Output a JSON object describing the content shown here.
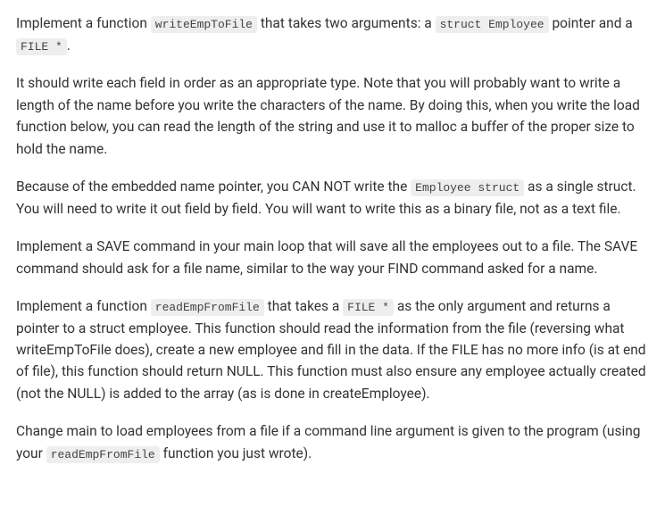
{
  "paragraphs": [
    {
      "segments": [
        {
          "type": "text",
          "value": "Implement a function "
        },
        {
          "type": "code",
          "value": "writeEmpToFile"
        },
        {
          "type": "text",
          "value": " that takes two arguments: a "
        },
        {
          "type": "code",
          "value": "struct Employee"
        },
        {
          "type": "text",
          "value": " pointer and a "
        },
        {
          "type": "code",
          "value": "FILE *"
        },
        {
          "type": "text",
          "value": "."
        }
      ]
    },
    {
      "segments": [
        {
          "type": "text",
          "value": "It should write each field in order as an appropriate type. Note that you will probably want to write a length of the name before you write the characters of the name. By doing this, when you write the load function below, you can read the length of the string and use it to malloc a buffer of the proper size to hold the name."
        }
      ]
    },
    {
      "segments": [
        {
          "type": "text",
          "value": "Because of the embedded name pointer, you CAN NOT write the "
        },
        {
          "type": "code",
          "value": "Employee struct"
        },
        {
          "type": "text",
          "value": " as a single struct. You will need to write it out field by field. You will want to write this as a binary file, not as a text file."
        }
      ]
    },
    {
      "segments": [
        {
          "type": "text",
          "value": "Implement a SAVE command in your main loop that will save all the employees out to a file. The SAVE command should ask for a file name, similar to the way your FIND command asked for a name."
        }
      ]
    },
    {
      "segments": [
        {
          "type": "text",
          "value": "Implement a function "
        },
        {
          "type": "code",
          "value": "readEmpFromFile"
        },
        {
          "type": "text",
          "value": " that takes a "
        },
        {
          "type": "code",
          "value": "FILE *"
        },
        {
          "type": "text",
          "value": " as the only argument and returns a pointer to a struct employee. This function should read the information from the file (reversing what writeEmpToFile does), create a new employee and fill in the data. If the FILE has no more info (is at end of file), this function should return NULL. This function must also ensure any employee actually created (not the NULL) is added to the array (as is done in createEmployee)."
        }
      ]
    },
    {
      "segments": [
        {
          "type": "text",
          "value": "Change main to load employees from a file if a command line argument is given to the program (using your "
        },
        {
          "type": "code",
          "value": "readEmpFromFile"
        },
        {
          "type": "text",
          "value": " function you just wrote)."
        }
      ]
    }
  ]
}
